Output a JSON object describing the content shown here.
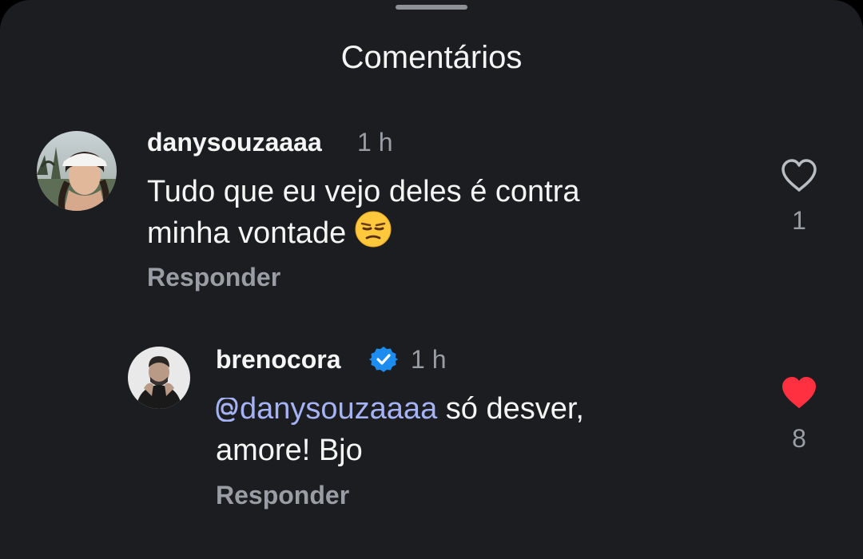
{
  "sheet": {
    "title": "Comentários"
  },
  "comments": [
    {
      "username": "danysouzaaaa",
      "time": "1 h",
      "text_line1": "Tudo que eu vejo deles é contra",
      "text_line2": "minha vontade",
      "emoji": "unamused-face",
      "reply_label": "Responder",
      "likes": "1",
      "liked": false
    },
    {
      "username": "brenocora",
      "verified": true,
      "time": "1 h",
      "mention": "danysouzaaaa",
      "text_after_mention": " só desver,",
      "text_line2": "amore! Bjo",
      "reply_label": "Responder",
      "likes": "8",
      "liked": true
    }
  ],
  "colors": {
    "background": "#1c1d20",
    "text": "#f5f5f5",
    "secondary": "#9a9da3",
    "mention": "#a5b3f5",
    "like_active": "#ff3040",
    "verified": "#1d8cf0"
  }
}
